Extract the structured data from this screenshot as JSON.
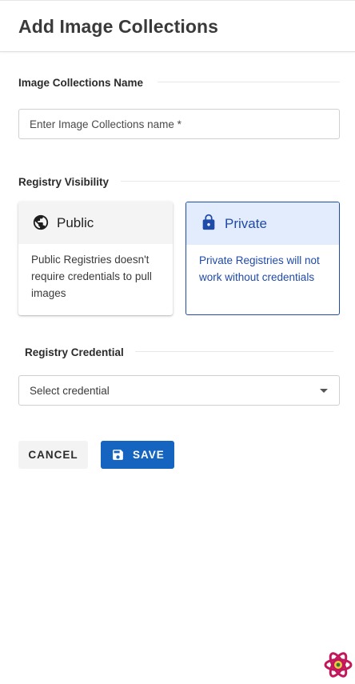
{
  "header": {
    "title": "Add Image Collections"
  },
  "name_section": {
    "label": "Image Collections Name",
    "input_placeholder": "Enter Image Collections name *"
  },
  "visibility_section": {
    "label": "Registry Visibility",
    "options": [
      {
        "title": "Public",
        "icon": "globe-icon",
        "description": "Public Registries doesn't require credentials to pull images",
        "selected": false
      },
      {
        "title": "Private",
        "icon": "lock-icon",
        "description": "Private Registries will not work without credentials",
        "selected": true
      }
    ]
  },
  "credential_section": {
    "label": "Registry Credential",
    "select_value": "Select credential"
  },
  "actions": {
    "cancel_label": "CANCEL",
    "save_label": "SAVE"
  },
  "colors": {
    "primary": "#1565c0",
    "selected_border": "#1f4aa8",
    "selected_bg": "#e3ecfd",
    "logo": "#c2185b"
  }
}
